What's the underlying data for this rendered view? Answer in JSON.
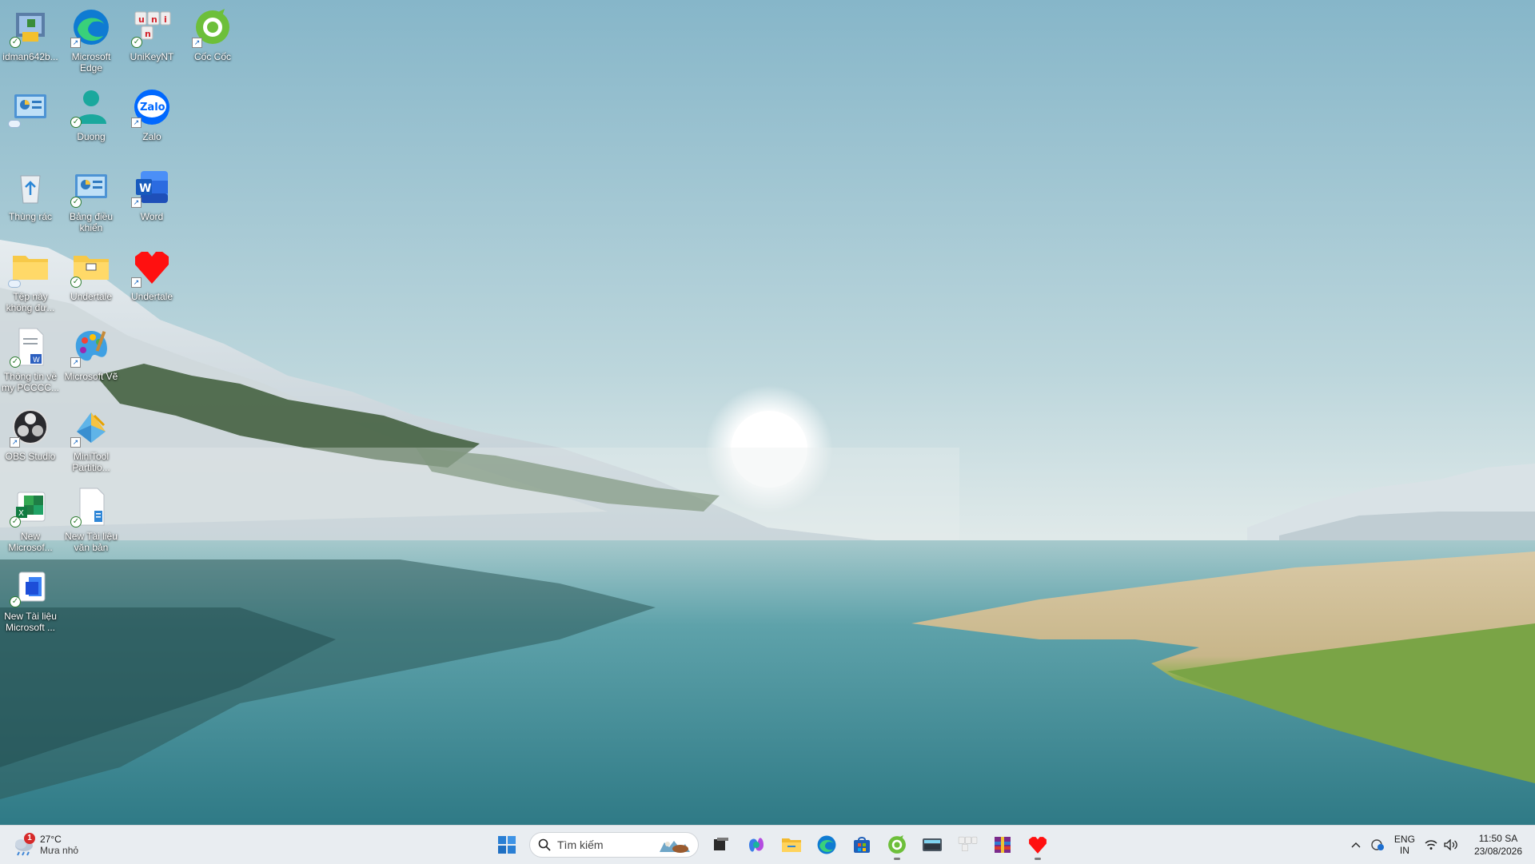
{
  "desktop": {
    "icons": [
      {
        "id": "idman",
        "label": "idman642b..."
      },
      {
        "id": "edge",
        "label": "Microsoft Edge"
      },
      {
        "id": "unikey",
        "label": "UniKeyNT"
      },
      {
        "id": "coccoc",
        "label": "Cốc Cốc"
      },
      {
        "id": "controlpanel1",
        "label": ""
      },
      {
        "id": "duong",
        "label": "Duong"
      },
      {
        "id": "zalo",
        "label": "Zalo"
      },
      {
        "id": "recycle",
        "label": "Thùng rác"
      },
      {
        "id": "controlpanel2",
        "label": "Bảng điều khiển"
      },
      {
        "id": "word",
        "label": "Word"
      },
      {
        "id": "folder-unsync",
        "label": "Tệp này không đư..."
      },
      {
        "id": "folder-undertale",
        "label": "Undertale"
      },
      {
        "id": "undertale-game",
        "label": "Undertale"
      },
      {
        "id": "doc-pcccc",
        "label": "Thông tin về my PCCCC..."
      },
      {
        "id": "paint",
        "label": "Microsoft Vẽ"
      },
      {
        "id": "obs",
        "label": "OBS Studio"
      },
      {
        "id": "minitool",
        "label": "MiniTool Partitio..."
      },
      {
        "id": "excel-new",
        "label": "New Microsof..."
      },
      {
        "id": "txt-new",
        "label": "New Tài liệu văn bản"
      },
      {
        "id": "word-new",
        "label": "New Tài liệu Microsoft ..."
      }
    ]
  },
  "taskbar": {
    "weather": {
      "temp": "27°C",
      "condition": "Mưa nhỏ",
      "notification_count": "1"
    },
    "search_placeholder": "Tìm kiếm",
    "apps": [
      "start",
      "search",
      "task-view",
      "m365-copilot",
      "file-explorer",
      "edge",
      "store",
      "coccoc",
      "screen-tool",
      "unikey",
      "winrar",
      "undertale"
    ],
    "tray": {
      "language_line1": "ENG",
      "language_line2": "IN",
      "time": "11:50 SA",
      "date": "23/08/2026"
    }
  },
  "colors": {
    "taskbar_bg": "#e9edf1",
    "sky_top": "#8ab9cb",
    "water": "#3f8e97",
    "grass": "#7fa74a"
  }
}
